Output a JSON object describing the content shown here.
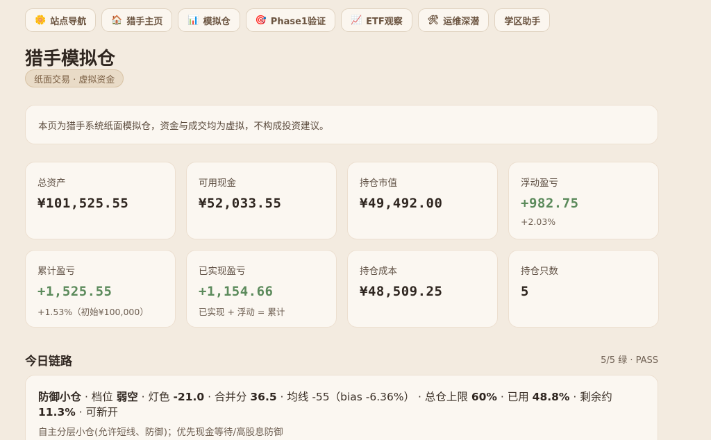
{
  "nav": [
    {
      "icon": "🌼",
      "label": "站点导航"
    },
    {
      "icon": "🏠",
      "label": "猎手主页"
    },
    {
      "icon": "📊",
      "label": "模拟仓"
    },
    {
      "icon": "🎯",
      "label": "Phase1验证"
    },
    {
      "icon": "📈",
      "label": "ETF观察"
    },
    {
      "icon": "🛠",
      "label": "运维深潜"
    },
    {
      "icon": "",
      "label": "学区助手"
    }
  ],
  "header": {
    "title": "猎手模拟仓",
    "tag": "纸面交易 · 虚拟资金"
  },
  "notice": "本页为猎手系统纸面模拟仓，资金与成交均为虚拟，不构成投资建议。",
  "cards": [
    {
      "label": "总资产",
      "value": "¥101,525.55",
      "sub": ""
    },
    {
      "label": "可用现金",
      "value": "¥52,033.55",
      "sub": ""
    },
    {
      "label": "持仓市值",
      "value": "¥49,492.00",
      "sub": ""
    },
    {
      "label": "浮动盈亏",
      "value": "+982.75",
      "sub": "+2.03%"
    },
    {
      "label": "累计盈亏",
      "value": "+1,525.55",
      "sub": "+1.53%（初始¥100,000）"
    },
    {
      "label": "已实现盈亏",
      "value": "+1,154.66",
      "sub": "已实现 + 浮动 = 累计"
    },
    {
      "label": "持仓成本",
      "value": "¥48,509.25",
      "sub": ""
    },
    {
      "label": "持仓只数",
      "value": "5",
      "sub": ""
    }
  ],
  "colors": {
    "positive": "#5b8a5b",
    "background": "#f3ebe0",
    "card": "#fbf7f1"
  },
  "chain": {
    "title": "今日链路",
    "status": "5/5 绿 · PASS",
    "mode": "防御小仓",
    "t1": " · 档位 ",
    "level": "弱空",
    "t2": " · 灯色 ",
    "light": "-21.0",
    "t3": " · 合并分 ",
    "score": "36.5",
    "t4": " · 均线 -55（bias -6.36%） · 总仓上限 ",
    "cap": "60%",
    "t5": " · 已用 ",
    "used": "48.8%",
    "t6": " · 剩余约 ",
    "remain": "11.3%",
    "t7": " · 可新开",
    "sub": "自主分层小仓(允许短线、防御)；优先现金等待/高股息防御"
  }
}
